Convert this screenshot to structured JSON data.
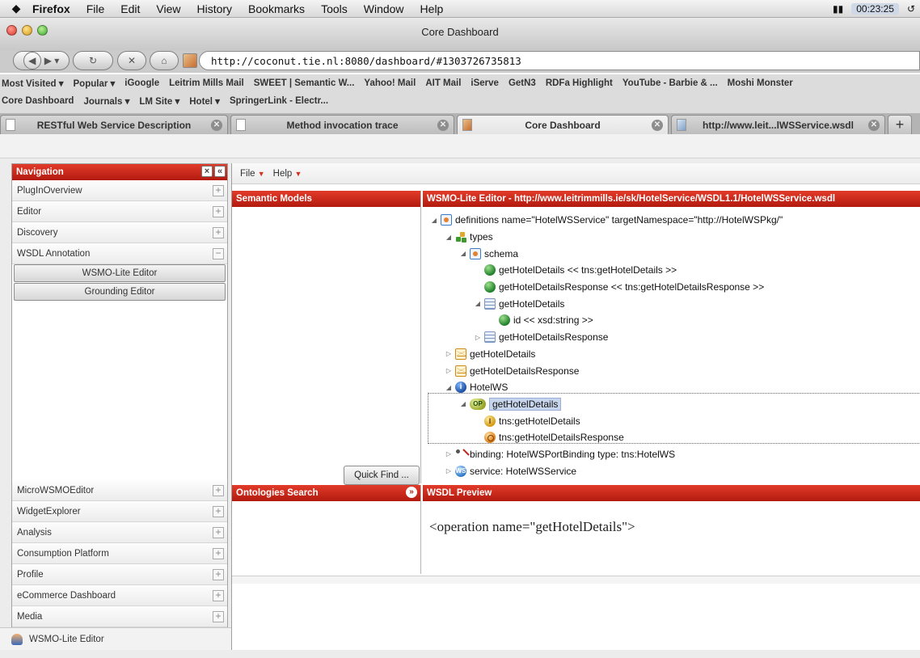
{
  "menubar": {
    "app": "Firefox",
    "items": [
      "File",
      "Edit",
      "View",
      "History",
      "Bookmarks",
      "Tools",
      "Window",
      "Help"
    ],
    "clock": "00:23:25"
  },
  "window": {
    "title": "Core Dashboard"
  },
  "navbar": {
    "url": "http://coconut.tie.nl:8080/dashboard/#1303726735813"
  },
  "bookmarks": {
    "row1": [
      "Most Visited ▾",
      "Popular ▾",
      "iGoogle",
      "Leitrim Mills Mail",
      "SWEET | Semantic W...",
      "Yahoo! Mail",
      "AIT Mail",
      "iServe",
      "GetN3",
      "RDFa Highlight",
      "YouTube - Barbie & ...",
      "Moshi Monster"
    ],
    "row2": [
      "Core Dashboard",
      "Journals ▾",
      "LM Site ▾",
      "Hotel ▾",
      "SpringerLink - Electr..."
    ]
  },
  "tabs": [
    {
      "label": "RESTful Web Service Description"
    },
    {
      "label": "Method invocation trace"
    },
    {
      "label": "Core Dashboard"
    },
    {
      "label": "http://www.leit...lWSService.wsdl"
    }
  ],
  "navigation": {
    "title": "Navigation",
    "items_top": [
      "PlugInOverview",
      "Editor",
      "Discovery",
      "WSDL Annotation"
    ],
    "sub_buttons": [
      "WSMO-Lite Editor",
      "Grounding Editor"
    ],
    "items_bottom": [
      "MicroWSMOEditor",
      "WidgetExplorer",
      "Analysis",
      "Consumption Platform",
      "Profile",
      "eCommerce Dashboard",
      "Media"
    ],
    "status": "WSMO-Lite Editor"
  },
  "main": {
    "menu": [
      "File",
      "Help"
    ],
    "semantic_models_title": "Semantic Models",
    "quick_find": "Quick Find ...",
    "editor_title": "WSMO-Lite Editor - http://www.leitrimmills.ie/sk/HotelService/WSDL1.1/HotelWSService.wsdl",
    "ontologies_title": "Ontologies Search",
    "preview_title": "WSDL Preview",
    "preview_text": "<operation name=\"getHotelDetails\">"
  },
  "tree": [
    "definitions name=\"HotelWSService\" targetNamespace=\"http://HotelWSPkg/\"",
    "types",
    "schema",
    "getHotelDetails << tns:getHotelDetails >>",
    "getHotelDetailsResponse << tns:getHotelDetailsResponse >>",
    "getHotelDetails",
    "id << xsd:string >>",
    "getHotelDetailsResponse",
    "getHotelDetails",
    "getHotelDetailsResponse",
    "HotelWS",
    "getHotelDetails",
    "tns:getHotelDetails",
    "tns:getHotelDetailsResponse",
    "binding: HotelWSPortBinding type: tns:HotelWS",
    "service: HotelWSService"
  ],
  "colors": {
    "header_red": "#c8261a",
    "selection": "#c7d5ec"
  }
}
